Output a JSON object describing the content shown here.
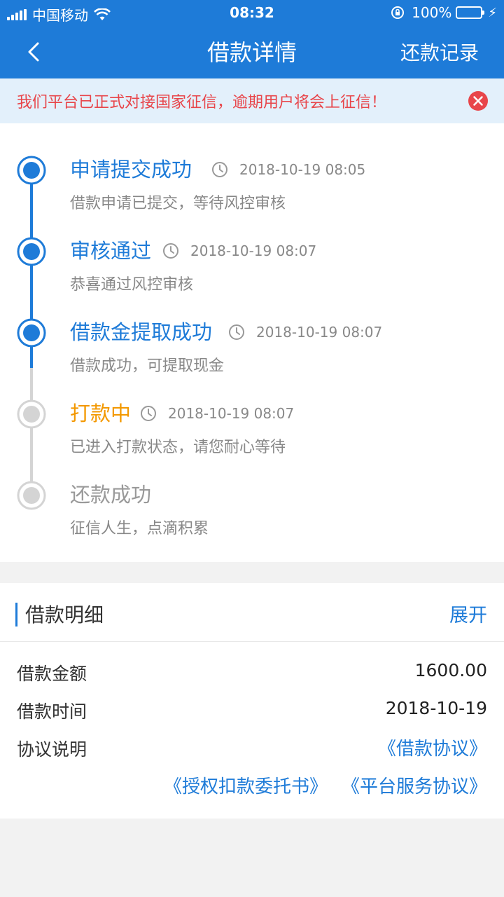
{
  "status_bar": {
    "carrier": "中国移动",
    "time": "08:32",
    "battery": "100%"
  },
  "nav": {
    "title": "借款详情",
    "right_label": "还款记录"
  },
  "notice": {
    "text": "我们平台已正式对接国家征信，逾期用户将会上征信！"
  },
  "timeline": [
    {
      "title": "申请提交成功",
      "time": "2018-10-19 08:05",
      "desc": "借款申请已提交，等待风控审核",
      "state": "done"
    },
    {
      "title": "审核通过",
      "time": "2018-10-19 08:07",
      "desc": "恭喜通过风控审核",
      "state": "done"
    },
    {
      "title": "借款金提取成功",
      "time": "2018-10-19 08:07",
      "desc": "借款成功，可提取现金",
      "state": "done"
    },
    {
      "title": "打款中",
      "time": "2018-10-19 08:07",
      "desc": "已进入打款状态，请您耐心等待",
      "state": "current"
    },
    {
      "title": "还款成功",
      "time": "",
      "desc": "征信人生，点滴积累",
      "state": "pending"
    }
  ],
  "detail": {
    "title": "借款明细",
    "expand_label": "展开",
    "rows": [
      {
        "label": "借款金额",
        "value": "1600.00"
      },
      {
        "label": "借款时间",
        "value": "2018-10-19"
      },
      {
        "label": "协议说明",
        "value": ""
      }
    ],
    "links": [
      "《借款协议》",
      "《授权扣款委托书》",
      "《平台服务协议》"
    ]
  },
  "colors": {
    "primary": "#1e7bd8",
    "current": "#f39800",
    "pending": "#999999",
    "notice_text": "#e8454a"
  }
}
